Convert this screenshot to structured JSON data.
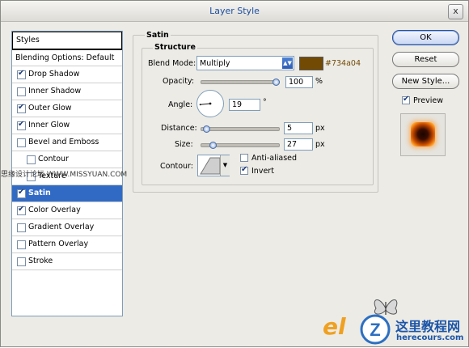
{
  "window": {
    "title": "Layer Style",
    "close_glyph": "x"
  },
  "styles_panel": {
    "header": "Styles",
    "items": [
      {
        "label": "Blending Options: Default",
        "checkbox": false,
        "checked": false,
        "indent": 0,
        "selected": false
      },
      {
        "label": "Drop Shadow",
        "checkbox": true,
        "checked": true,
        "indent": 0,
        "selected": false
      },
      {
        "label": "Inner Shadow",
        "checkbox": true,
        "checked": false,
        "indent": 0,
        "selected": false
      },
      {
        "label": "Outer Glow",
        "checkbox": true,
        "checked": true,
        "indent": 0,
        "selected": false
      },
      {
        "label": "Inner Glow",
        "checkbox": true,
        "checked": true,
        "indent": 0,
        "selected": false
      },
      {
        "label": "Bevel and Emboss",
        "checkbox": true,
        "checked": false,
        "indent": 0,
        "selected": false
      },
      {
        "label": "Contour",
        "checkbox": true,
        "checked": false,
        "indent": 1,
        "selected": false
      },
      {
        "label": "Texture",
        "checkbox": true,
        "checked": false,
        "indent": 1,
        "selected": false
      },
      {
        "label": "Satin",
        "checkbox": true,
        "checked": true,
        "indent": 0,
        "selected": true
      },
      {
        "label": "Color Overlay",
        "checkbox": true,
        "checked": true,
        "indent": 0,
        "selected": false
      },
      {
        "label": "Gradient Overlay",
        "checkbox": true,
        "checked": false,
        "indent": 0,
        "selected": false
      },
      {
        "label": "Pattern Overlay",
        "checkbox": true,
        "checked": false,
        "indent": 0,
        "selected": false
      },
      {
        "label": "Stroke",
        "checkbox": true,
        "checked": false,
        "indent": 0,
        "selected": false
      }
    ]
  },
  "watermark_left": "思缘设计论坛 WWW.MISSYUAN.COM",
  "satin": {
    "group_title": "Satin",
    "structure_title": "Structure",
    "blend_mode_label": "Blend Mode:",
    "blend_mode_value": "Multiply",
    "color_hex_label": "#734a04",
    "color": "#734a04",
    "opacity_label": "Opacity:",
    "opacity_value": "100",
    "opacity_unit": "%",
    "opacity_fraction": 1.0,
    "angle_label": "Angle:",
    "angle_value": "19",
    "angle_unit": "°",
    "distance_label": "Distance:",
    "distance_value": "5",
    "distance_unit": "px",
    "distance_fraction": 0.02,
    "size_label": "Size:",
    "size_value": "27",
    "size_unit": "px",
    "size_fraction": 0.11,
    "contour_label": "Contour:",
    "anti_aliased_label": "Anti-aliased",
    "anti_aliased_checked": false,
    "invert_label": "Invert",
    "invert_checked": true
  },
  "buttons": {
    "ok": "OK",
    "reset": "Reset",
    "new_style": "New Style...",
    "preview_label": "Preview",
    "preview_checked": true
  },
  "footer_logos": {
    "brand_cn": "这里教程网",
    "brand_url": "herecours.com"
  }
}
